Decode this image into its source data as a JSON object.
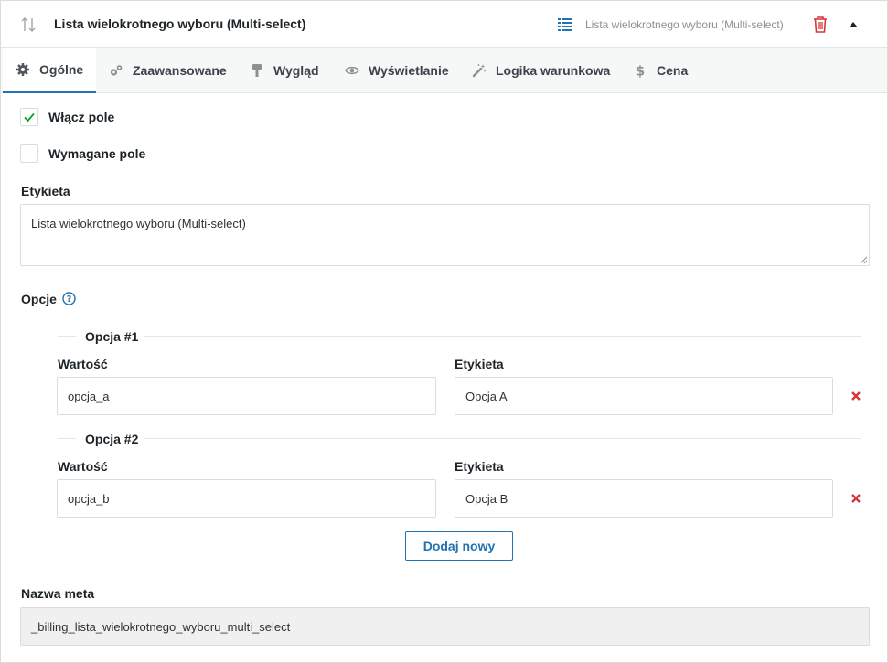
{
  "header": {
    "title": "Lista wielokrotnego wyboru (Multi-select)",
    "field_type": "Lista wielokrotnego wyboru (Multi-select)",
    "icons": [
      "sort-icon",
      "list-icon",
      "trash-icon",
      "caret-up-icon"
    ]
  },
  "tabs": [
    {
      "label": "Ogólne",
      "icon": "gear-icon",
      "active": true
    },
    {
      "label": "Zaawansowane",
      "icon": "gears-icon",
      "active": false
    },
    {
      "label": "Wygląd",
      "icon": "paint-roller-icon",
      "active": false
    },
    {
      "label": "Wyświetlanie",
      "icon": "eye-icon",
      "active": false
    },
    {
      "label": "Logika warunkowa",
      "icon": "magic-wand-icon",
      "active": false
    },
    {
      "label": "Cena",
      "icon": "dollar-icon",
      "active": false
    }
  ],
  "settings": {
    "enable_field": {
      "label": "Włącz pole",
      "checked": true
    },
    "required_field": {
      "label": "Wymagane pole",
      "checked": false
    }
  },
  "label_field": {
    "label": "Etykieta",
    "value": "Lista wielokrotnego wyboru (Multi-select)"
  },
  "options": {
    "label": "Opcje",
    "items": [
      {
        "legend": "Opcja #1",
        "value_label": "Wartość",
        "value": "opcja_a",
        "label_label": "Etykieta",
        "label": "Opcja A"
      },
      {
        "legend": "Opcja #2",
        "value_label": "Wartość",
        "value": "opcja_b",
        "label_label": "Etykieta",
        "label": "Opcja B"
      }
    ],
    "add_button": "Dodaj nowy"
  },
  "meta": {
    "label": "Nazwa meta",
    "value": "_billing_lista_wielokrotnego_wyboru_multi_select"
  },
  "colors": {
    "accent": "#2271b1",
    "danger": "#d63638",
    "check": "#00a32a"
  }
}
